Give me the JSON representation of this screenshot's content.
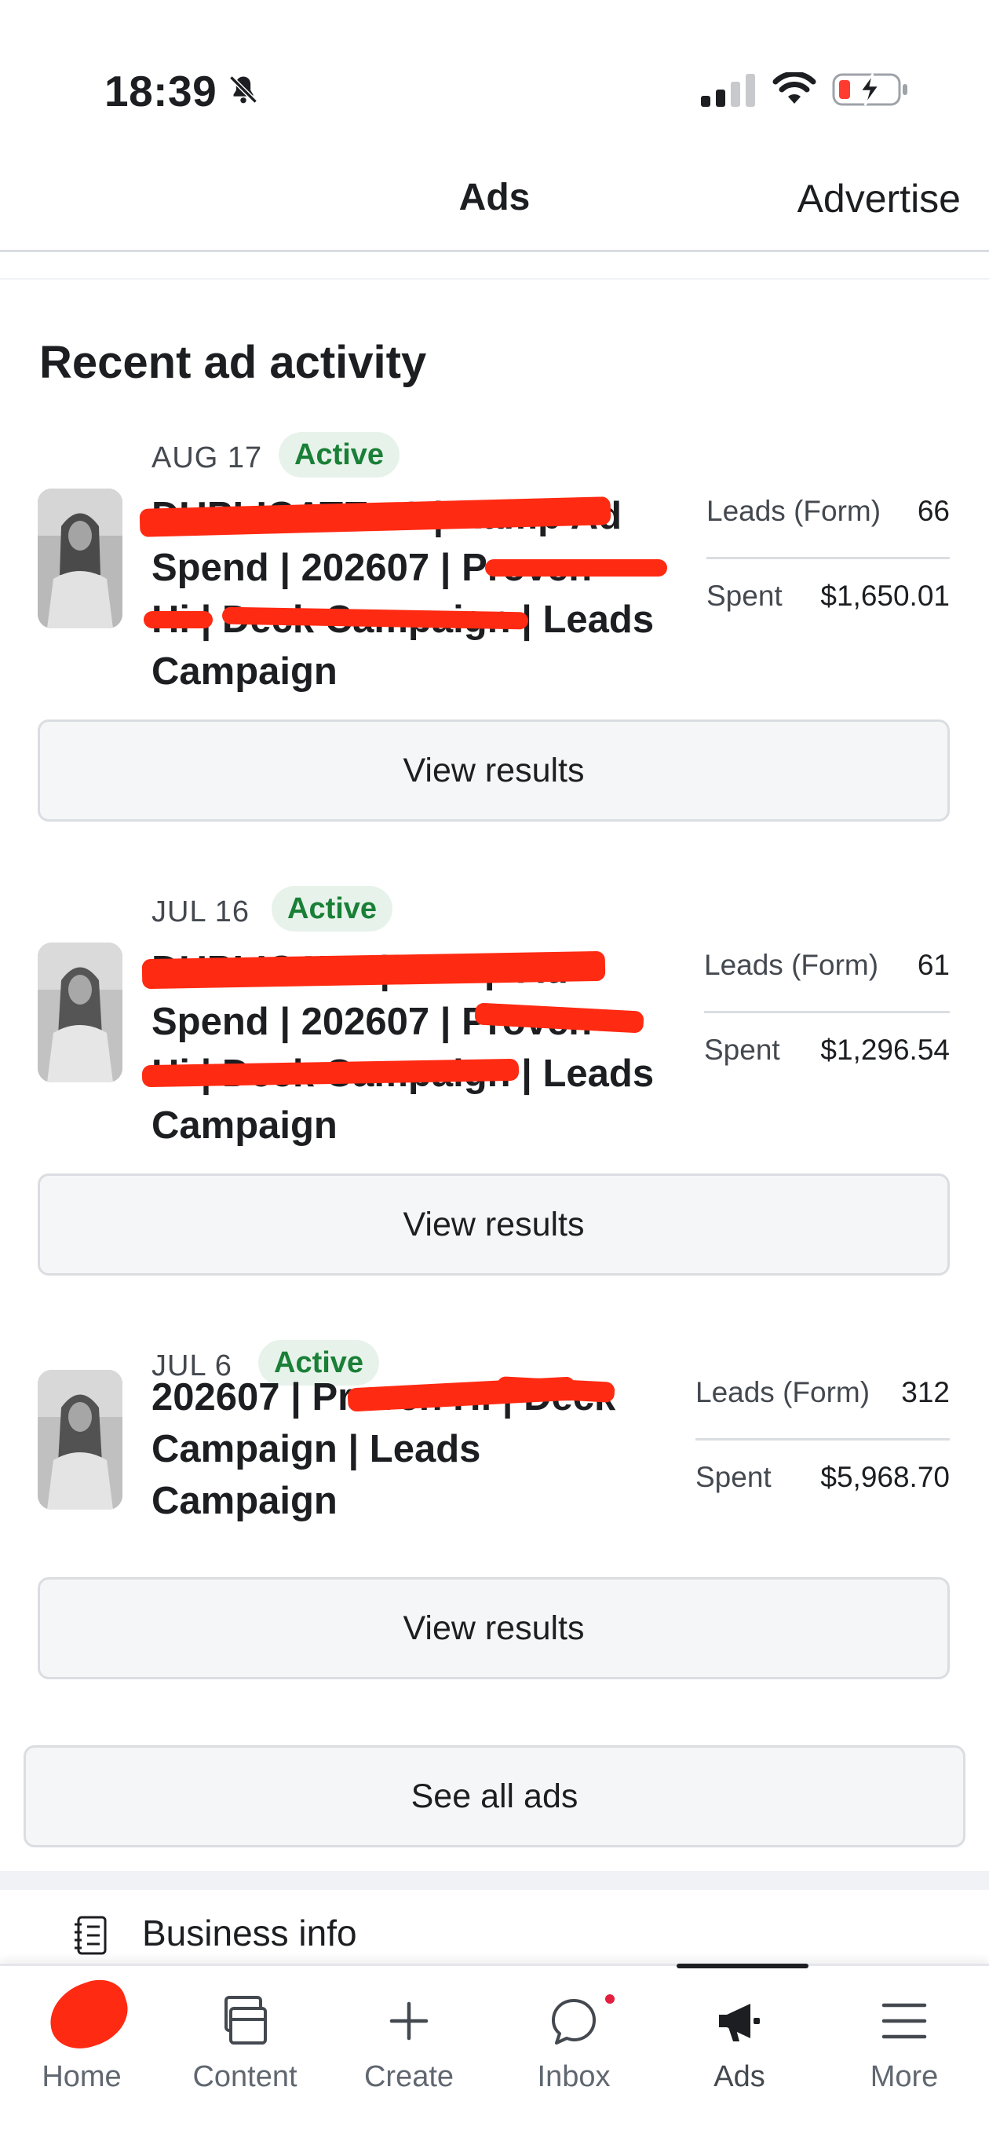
{
  "status_bar": {
    "time": "18:39",
    "icons": [
      "bell-slash-icon",
      "cellular-signal-icon",
      "wifi-icon",
      "battery-charging-icon"
    ]
  },
  "header": {
    "title": "Ads",
    "advertise_label": "Advertise"
  },
  "section": {
    "heading": "Recent ad activity"
  },
  "ads": [
    {
      "date": "AUG 17",
      "status": "Active",
      "name_lines": [
        "DUPLICATE #2 | Ramp Ad",
        "Spend | 202607 | Proven",
        "Hi | Deck Campaign | Leads",
        "Campaign"
      ],
      "metrics": [
        {
          "label": "Leads (Form)",
          "value": "66"
        },
        {
          "label": "Spent",
          "value": "$1,650.01"
        }
      ],
      "button_label": "View results"
    },
    {
      "date": "JUL 16",
      "status": "Active",
      "name_lines": [
        "DUPLICATE | Ramp Ad",
        "Spend | 202607 | Proven",
        "Hi | Deck Campaign | Leads",
        "Campaign"
      ],
      "metrics": [
        {
          "label": "Leads (Form)",
          "value": "61"
        },
        {
          "label": "Spent",
          "value": "$1,296.54"
        }
      ],
      "button_label": "View results"
    },
    {
      "date": "JUL 6",
      "status": "Active",
      "name_lines": [
        "202607 | Proven Hi | Deck",
        "Campaign | Leads",
        "Campaign"
      ],
      "metrics": [
        {
          "label": "Leads (Form)",
          "value": "312"
        },
        {
          "label": "Spent",
          "value": "$5,968.70"
        }
      ],
      "button_label": "View results"
    }
  ],
  "see_all_label": "See all ads",
  "business_info": {
    "label": "Business info",
    "icon": "document-list-icon"
  },
  "bottom_nav": {
    "active": "Ads",
    "items": [
      {
        "label": "Home",
        "icon": "home-icon"
      },
      {
        "label": "Content",
        "icon": "content-icon"
      },
      {
        "label": "Create",
        "icon": "plus-icon"
      },
      {
        "label": "Inbox",
        "icon": "chat-bubble-icon"
      },
      {
        "label": "Ads",
        "icon": "megaphone-icon"
      },
      {
        "label": "More",
        "icon": "menu-icon"
      }
    ]
  },
  "colors": {
    "active_green": "#1a7f37",
    "active_bg": "#e7f3ea",
    "redaction": "#ff2a12",
    "notification_dot": "#e41e3f"
  }
}
